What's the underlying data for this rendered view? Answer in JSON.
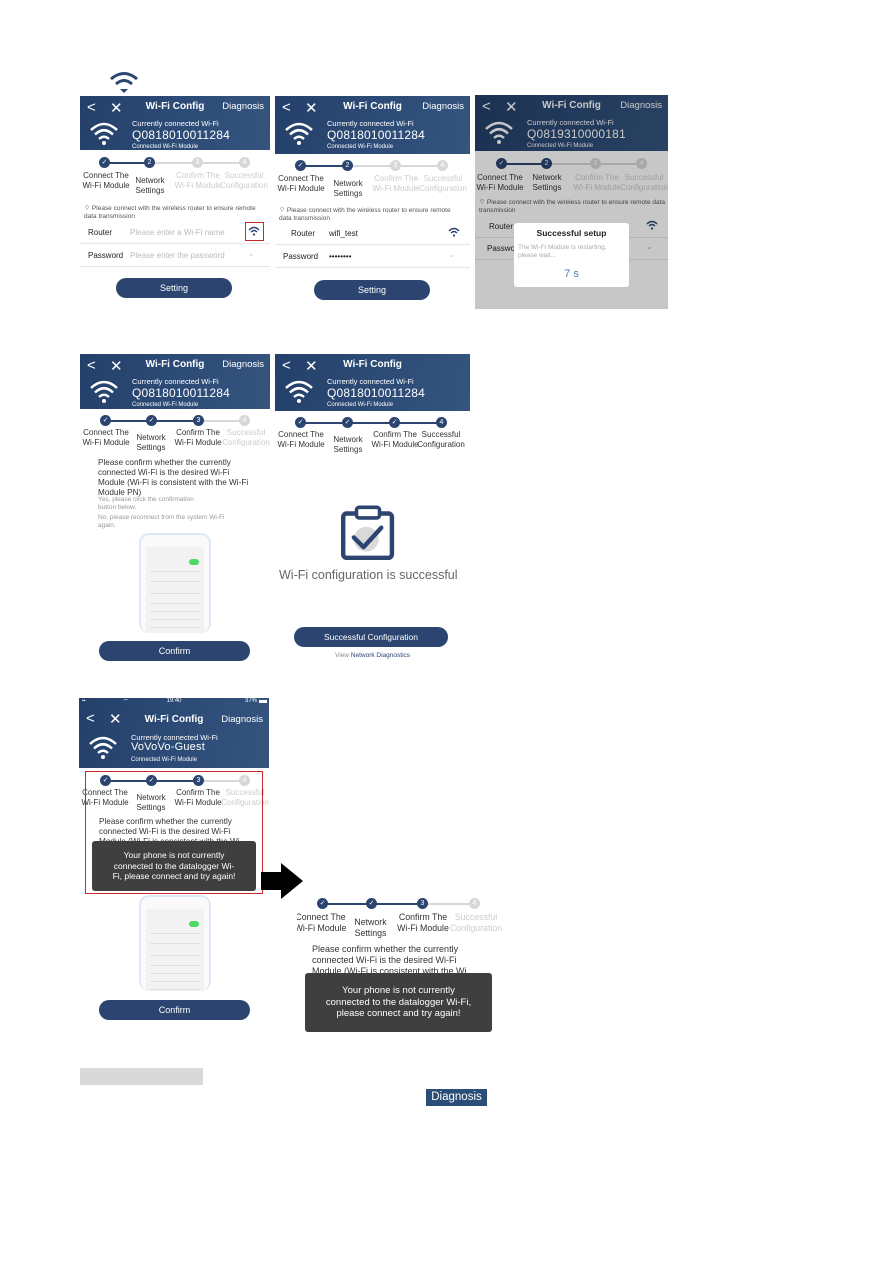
{
  "top_icon": "wifi-icon",
  "header_common": {
    "title": "Wi-Fi Config",
    "diagnosis": "Diagnosis",
    "currently": "Currently connected Wi-Fi",
    "module": "Connected Wi-Fi Module"
  },
  "steps": {
    "s1": "Connect The Wi-Fi Module",
    "s2": "Network Settings",
    "s3": "Confirm The Wi-Fi Module",
    "s4": "Successful Configuration"
  },
  "screen1": {
    "ssid": "Q0818010011284",
    "note": "Please connect with the wireless router to ensure remote data transmission",
    "router_label": "Router",
    "router_placeholder": "Please enter a Wi-Fi name",
    "password_label": "Password",
    "password_placeholder": "Please enter the password",
    "button": "Setting"
  },
  "screen2": {
    "ssid": "Q0818010011284",
    "note": "Please connect with the wireless router to ensure remote data transmission",
    "router_label": "Router",
    "router_value": "wifi_test",
    "password_label": "Password",
    "password_value": "••••••••",
    "button": "Setting"
  },
  "screen3": {
    "ssid": "Q0819310000181",
    "note": "Please connect with the wireless router to ensure remote data transmission",
    "router_label": "Router",
    "password_label": "Password",
    "dialog_title": "Successful setup",
    "dialog_text": "The Wi-Fi Module is restarting, please wait...",
    "countdown": "7 s"
  },
  "screen4": {
    "ssid": "Q0818010011284",
    "para": "Please confirm whether the currently connected Wi-Fi is the desired Wi-Fi Module (Wi-Fi is consistent with the Wi-Fi Module PN)",
    "yes": "Yes, please click the confirmation button below;",
    "no": "No, please reconnect from the system Wi-Fi again.",
    "button": "Confirm"
  },
  "screen5": {
    "ssid": "Q0818010011284",
    "success": "Wi-Fi configuration is successful",
    "button": "Successful Configuration",
    "view_prefix": "View ",
    "view_link": "Network Diagnostics"
  },
  "screen6": {
    "status_time": "19:40",
    "status_battery": "37%",
    "ssid": "VoVoVo-Guest",
    "para": "Please confirm whether the currently connected Wi-Fi is the desired Wi-Fi Module (Wi-Fi is consistent with the Wi-",
    "toast": "Your phone is not currently connected to the datalogger Wi-Fi, please connect and try again!",
    "button": "Confirm"
  },
  "screen7": {
    "para": "Please confirm whether the currently connected Wi-Fi is the desired Wi-Fi Module (Wi-Fi is consistent with the Wi",
    "toast": "Your phone is not currently connected to the datalogger Wi-Fi, please connect and try again!"
  },
  "footer": {
    "diagnosis_badge": "Diagnosis"
  }
}
